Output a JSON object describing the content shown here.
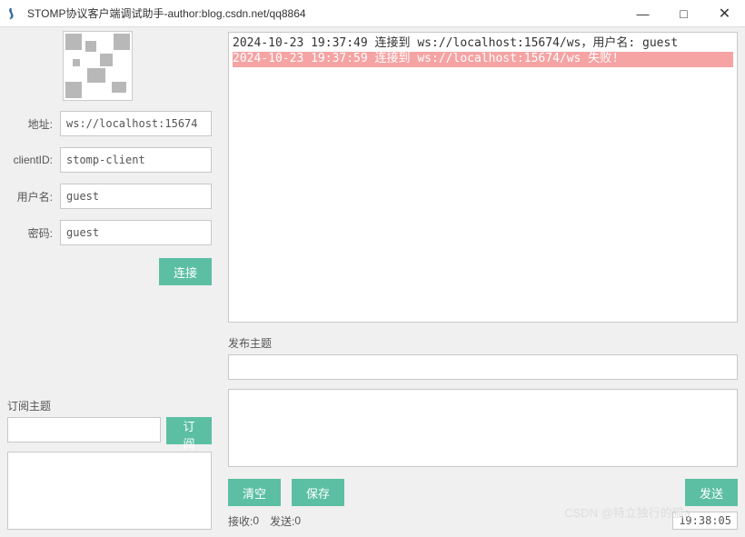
{
  "window": {
    "title": "STOMP协议客户端调试助手-author:blog.csdn.net/qq8864"
  },
  "form": {
    "address_label": "地址:",
    "address_value": "ws://localhost:15674",
    "clientid_label": "clientID:",
    "clientid_value": "stomp-client",
    "user_label": "用户名:",
    "user_value": "guest",
    "pass_label": "密码:",
    "pass_value": "guest",
    "connect_btn": "连接"
  },
  "subscribe": {
    "title": "订阅主题",
    "input_value": "",
    "btn": "订阅"
  },
  "publish": {
    "title": "发布主题",
    "input_value": "",
    "msg_value": "",
    "clear_btn": "清空",
    "save_btn": "保存",
    "send_btn": "发送"
  },
  "log": {
    "lines": [
      {
        "text": "2024-10-23 19:37:49 连接到 ws://localhost:15674/ws，用户名: guest",
        "err": false
      },
      {
        "text": "2024-10-23 19:37:59 连接到 ws://localhost:15674/ws 失败!",
        "err": true
      }
    ]
  },
  "status": {
    "recv_label": "接收:",
    "recv_count": "0",
    "send_label": "发送:",
    "send_count": "0",
    "clock": "19:38:05"
  },
  "watermark": "CSDN @特立独行的猫a"
}
